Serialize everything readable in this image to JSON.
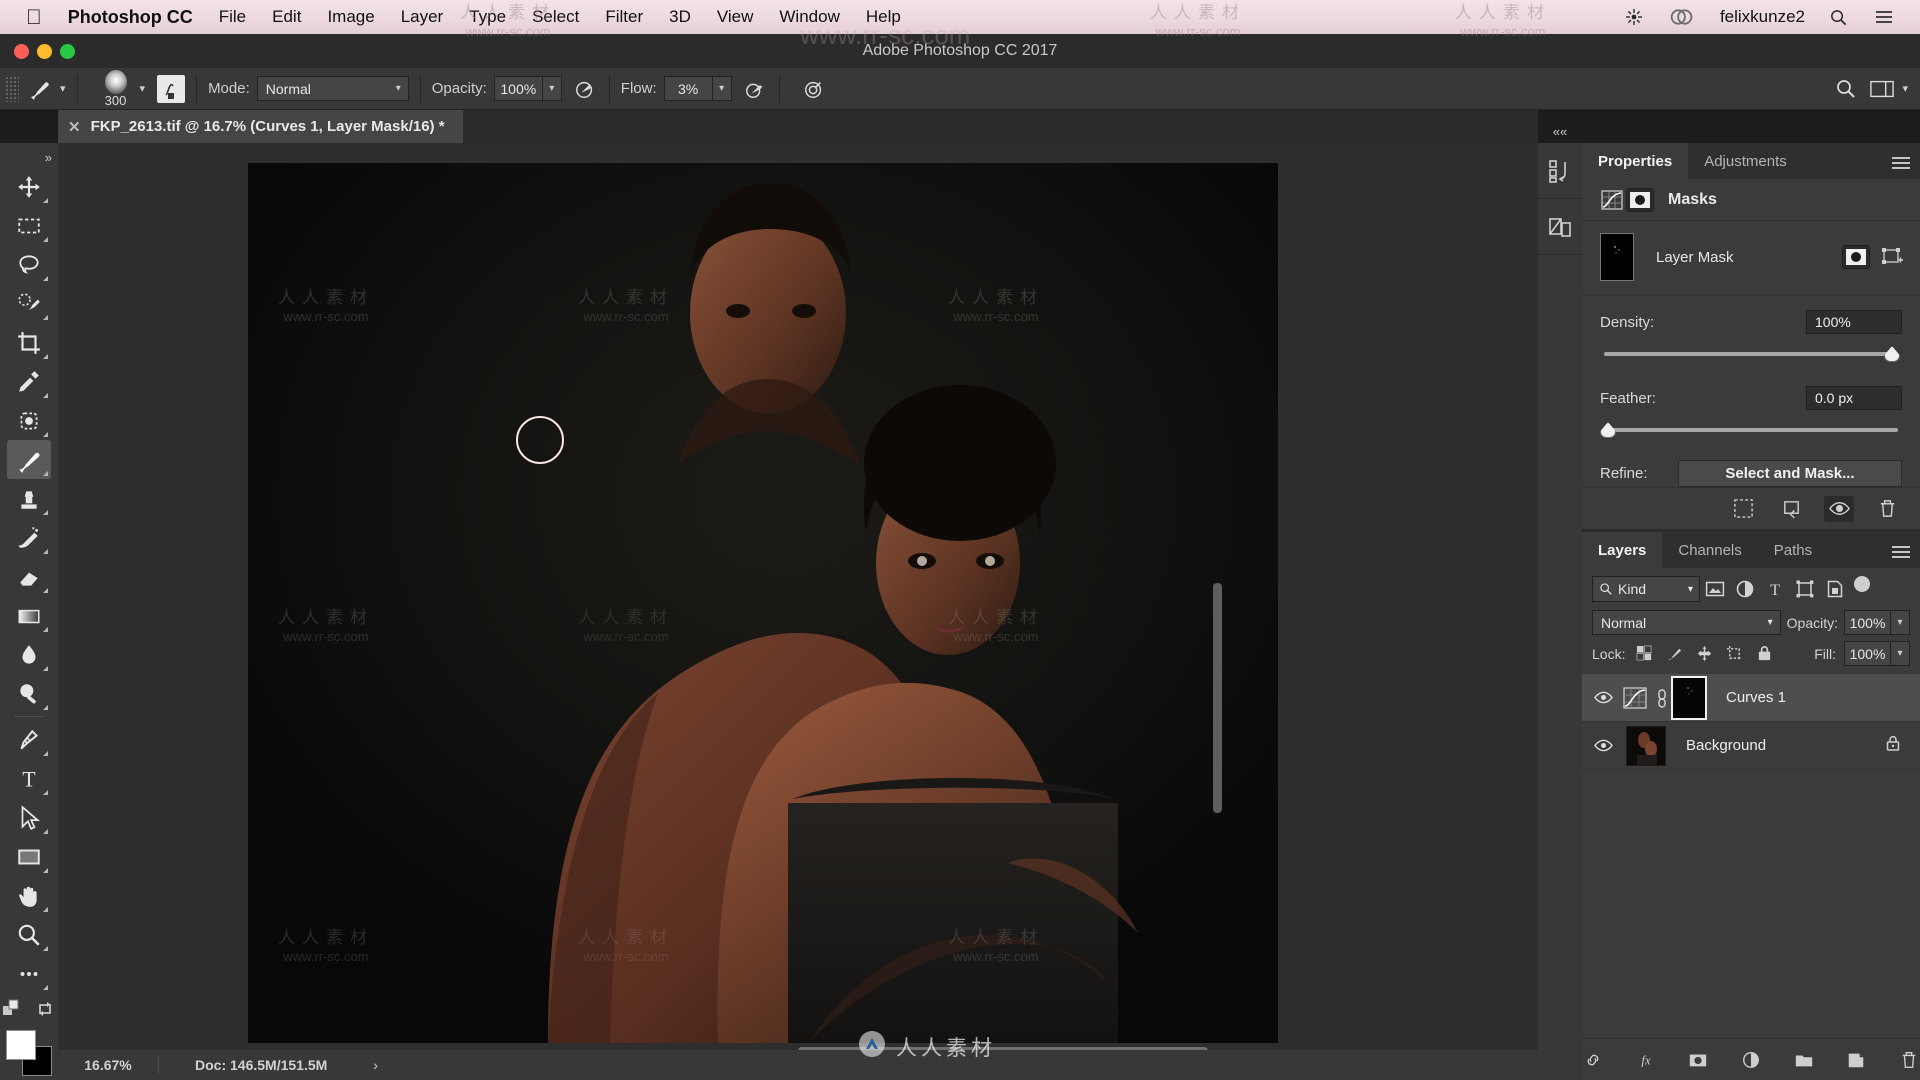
{
  "macos_menu": {
    "apple_icon": "apple-icon",
    "app_name": "Photoshop CC",
    "items": [
      "File",
      "Edit",
      "Image",
      "Layer",
      "Type",
      "Select",
      "Filter",
      "3D",
      "View",
      "Window",
      "Help"
    ],
    "right": {
      "brightness_icon": "brightness-icon",
      "creative_cloud_icon": "creative-cloud-icon",
      "user": "felixkunze2",
      "search_icon": "search-icon",
      "notification_icon": "list-menu-icon"
    }
  },
  "window": {
    "title": "Adobe Photoshop CC 2017"
  },
  "options_bar": {
    "tool_icon": "brush-icon",
    "brush_size": "300",
    "mode_label": "Mode:",
    "mode_value": "Normal",
    "opacity_label": "Opacity:",
    "opacity_value": "100%",
    "flow_label": "Flow:",
    "flow_value": "3%",
    "airbrush_icon": "airbrush-icon",
    "smoothing_icon": "smoothing-icon",
    "search_icon": "search-icon",
    "workspace_icon": "workspace-icon"
  },
  "document_tab": {
    "close_icon": "close-icon",
    "title": "FKP_2613.tif @ 16.7% (Curves 1, Layer Mask/16) *"
  },
  "toolbar": {
    "tools": [
      {
        "name": "move-tool",
        "selected": false
      },
      {
        "name": "rectangular-marquee-tool",
        "selected": false
      },
      {
        "name": "lasso-tool",
        "selected": false
      },
      {
        "name": "quick-selection-tool",
        "selected": false
      },
      {
        "name": "crop-tool",
        "selected": false
      },
      {
        "name": "eyedropper-tool",
        "selected": false
      },
      {
        "name": "spot-healing-brush-tool",
        "selected": false
      },
      {
        "name": "brush-tool",
        "selected": true
      },
      {
        "name": "clone-stamp-tool",
        "selected": false
      },
      {
        "name": "history-brush-tool",
        "selected": false
      },
      {
        "name": "eraser-tool",
        "selected": false
      },
      {
        "name": "gradient-tool",
        "selected": false
      },
      {
        "name": "blur-tool",
        "selected": false
      },
      {
        "name": "dodge-tool",
        "selected": false
      },
      {
        "name": "pen-tool",
        "selected": false
      },
      {
        "name": "type-tool",
        "selected": false
      },
      {
        "name": "path-selection-tool",
        "selected": false
      },
      {
        "name": "rectangle-tool",
        "selected": false
      },
      {
        "name": "hand-tool",
        "selected": false
      },
      {
        "name": "zoom-tool",
        "selected": false
      },
      {
        "name": "more-tools",
        "selected": false
      }
    ],
    "foreground_color": "#ffffff",
    "background_color": "#000000"
  },
  "status_bar": {
    "zoom": "16.67%",
    "doc": "Doc: 146.5M/151.5M",
    "arrow": "›"
  },
  "icon_rail": {
    "collapse": "««",
    "buttons": [
      "history-panel-icon",
      "libraries-panel-icon"
    ]
  },
  "properties_panel": {
    "tabs": [
      {
        "label": "Properties",
        "active": true
      },
      {
        "label": "Adjustments",
        "active": false
      }
    ],
    "menu_icon": "panel-menu-icon",
    "section_title": "Masks",
    "curves_icon": "curves-icon",
    "mask_icon": "pixel-mask-icon",
    "mask_name": "Layer Mask",
    "pixel_mask_button": "pixel-mask-icon",
    "vector_mask_button": "vector-mask-icon",
    "density_label": "Density:",
    "density_value": "100%",
    "feather_label": "Feather:",
    "feather_value": "0.0 px",
    "refine_label": "Refine:",
    "select_and_mask_label": "Select and Mask...",
    "footer_icons": [
      "load-selection-icon",
      "apply-mask-icon",
      "toggle-mask-icon",
      "delete-mask-icon"
    ]
  },
  "layers_panel": {
    "tabs": [
      {
        "label": "Layers",
        "active": true
      },
      {
        "label": "Channels",
        "active": false
      },
      {
        "label": "Paths",
        "active": false
      }
    ],
    "menu_icon": "panel-menu-icon",
    "filter_kind_label": "Kind",
    "filter_search_icon": "search-icon",
    "filter_icons": [
      "image-filter-icon",
      "adjustment-filter-icon",
      "type-filter-icon",
      "shape-filter-icon",
      "smart-object-filter-icon"
    ],
    "filter_toggle": "filter-toggle",
    "blend_mode": "Normal",
    "opacity_label": "Opacity:",
    "opacity_value": "100%",
    "lock_label": "Lock:",
    "lock_icons": [
      "lock-transparent-pixels-icon",
      "lock-image-pixels-icon",
      "lock-position-icon",
      "lock-artboard-icon",
      "lock-all-icon"
    ],
    "fill_label": "Fill:",
    "fill_value": "100%",
    "layers": [
      {
        "name": "Curves 1",
        "visible": true,
        "selected": true,
        "type": "adjustment",
        "has_mask": true,
        "linked": true,
        "locked": false
      },
      {
        "name": "Background",
        "visible": true,
        "selected": false,
        "type": "image",
        "has_mask": false,
        "linked": false,
        "locked": true
      }
    ],
    "footer_icons": [
      "link-layers-icon",
      "layer-style-icon",
      "add-layer-mask-icon",
      "new-adjustment-layer-icon",
      "new-group-icon",
      "new-layer-icon",
      "delete-layer-icon"
    ]
  },
  "watermark": {
    "cjk": "人人素材",
    "url": "www.rr-sc.com"
  },
  "colors": {
    "panel_bg": "#3b3b3b",
    "panel_dark": "#2b2b2b",
    "toolbar_bg": "#383838",
    "canvas_bg": "#2e2e2e",
    "selected_layer": "#4e4e4e",
    "text": "#e6e6e6"
  }
}
